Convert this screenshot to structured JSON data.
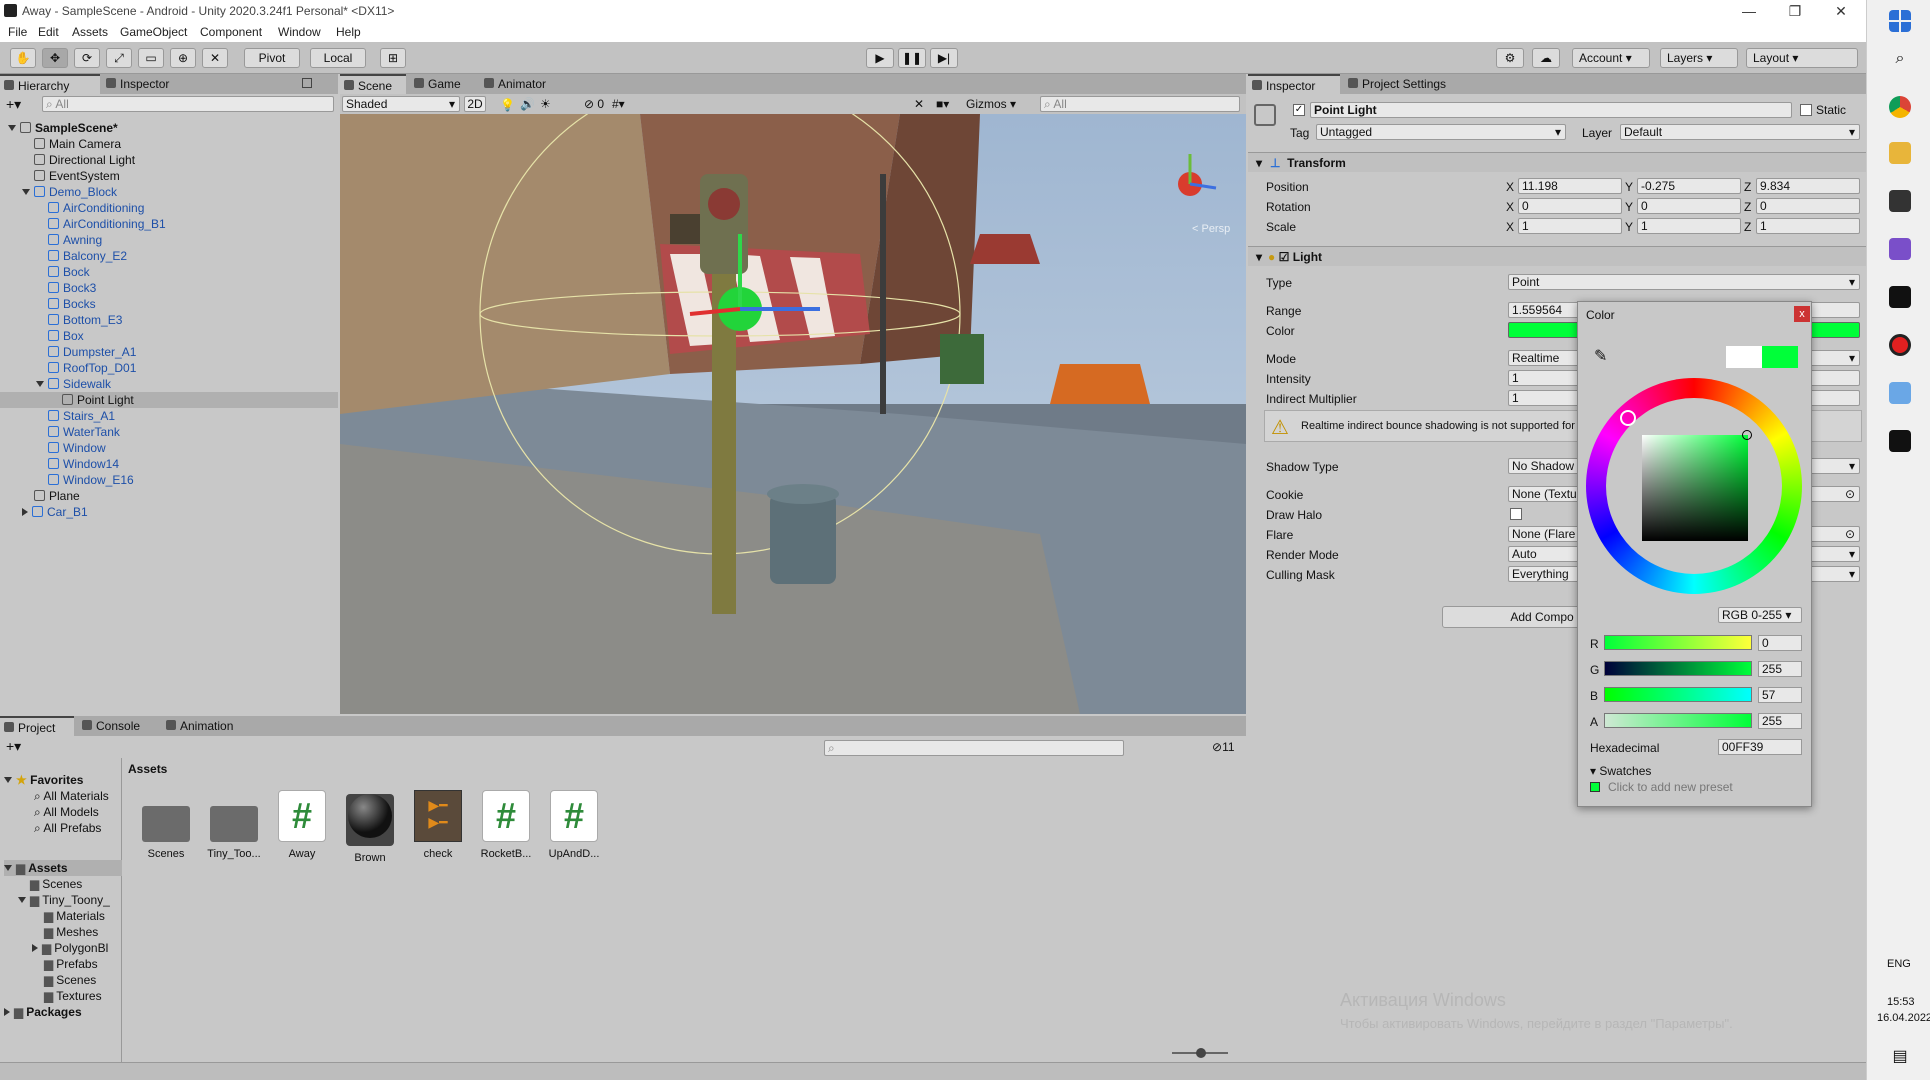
{
  "window": {
    "title": "Away - SampleScene - Android - Unity 2020.3.24f1 Personal* <DX11>"
  },
  "menu": [
    "File",
    "Edit",
    "Assets",
    "GameObject",
    "Component",
    "Window",
    "Help"
  ],
  "toolbar": {
    "pivot": "Pivot",
    "local": "Local",
    "account": "Account",
    "layers": "Layers",
    "layout": "Layout"
  },
  "hierarchy": {
    "tab": "Hierarchy",
    "inspector_tab": "Inspector",
    "search_placeholder": "All",
    "items": [
      {
        "label": "SampleScene*"
      },
      {
        "label": "Main Camera"
      },
      {
        "label": "Directional Light"
      },
      {
        "label": "EventSystem"
      },
      {
        "label": "Demo_Block"
      },
      {
        "label": "AirConditioning"
      },
      {
        "label": "AirConditioning_B1"
      },
      {
        "label": "Awning"
      },
      {
        "label": "Balcony_E2"
      },
      {
        "label": "Bock"
      },
      {
        "label": "Bock3"
      },
      {
        "label": "Bocks"
      },
      {
        "label": "Bottom_E3"
      },
      {
        "label": "Box"
      },
      {
        "label": "Dumpster_A1"
      },
      {
        "label": "RoofTop_D01"
      },
      {
        "label": "Sidewalk"
      },
      {
        "label": "Point Light"
      },
      {
        "label": "Stairs_A1"
      },
      {
        "label": "WaterTank"
      },
      {
        "label": "Window"
      },
      {
        "label": "Window14"
      },
      {
        "label": "Window_E16"
      },
      {
        "label": "Plane"
      },
      {
        "label": "Car_B1"
      }
    ]
  },
  "scene": {
    "tabs": [
      "Scene",
      "Game",
      "Animator"
    ],
    "shading": "Shaded",
    "mode2d": "2D",
    "hidden_count": "0",
    "gizmos": "Gizmos",
    "search_placeholder": "All",
    "persp": "< Persp"
  },
  "inspector": {
    "tabs": [
      "Inspector",
      "Project Settings"
    ],
    "object_name": "Point Light",
    "static_label": "Static",
    "tag_label": "Tag",
    "tag_value": "Untagged",
    "layer_label": "Layer",
    "layer_value": "Default",
    "transform": {
      "title": "Transform",
      "position_label": "Position",
      "rotation_label": "Rotation",
      "scale_label": "Scale",
      "position": {
        "x": "11.198",
        "y": "-0.275",
        "z": "9.834"
      },
      "rotation": {
        "x": "0",
        "y": "0",
        "z": "0"
      },
      "scale": {
        "x": "1",
        "y": "1",
        "z": "1"
      }
    },
    "light": {
      "title": "Light",
      "type_label": "Type",
      "type_value": "Point",
      "range_label": "Range",
      "range_value": "1.559564",
      "color_label": "Color",
      "mode_label": "Mode",
      "mode_value": "Realtime",
      "intensity_label": "Intensity",
      "intensity_value": "1",
      "indirect_label": "Indirect Multiplier",
      "indirect_value": "1",
      "warning": "Realtime indirect bounce shadowing is not supported for",
      "shadow_label": "Shadow Type",
      "shadow_value": "No Shadow",
      "cookie_label": "Cookie",
      "cookie_value": "None (Textu",
      "halo_label": "Draw Halo",
      "flare_label": "Flare",
      "flare_value": "None (Flare",
      "render_label": "Render Mode",
      "render_value": "Auto",
      "culling_label": "Culling Mask",
      "culling_value": "Everything"
    },
    "add_component": "Add Compo",
    "color_hex": "#00FF39"
  },
  "color_picker": {
    "title": "Color",
    "mode": "RGB 0-255",
    "r_label": "R",
    "r": "0",
    "g_label": "G",
    "g": "255",
    "b_label": "B",
    "b": "57",
    "a_label": "A",
    "a": "255",
    "hex_label": "Hexadecimal",
    "hex": "00FF39",
    "swatches": "Swatches",
    "swatch_hint": "Click to add new preset"
  },
  "project": {
    "tabs": [
      "Project",
      "Console",
      "Animation"
    ],
    "hidden_count": "11",
    "favorites": "Favorites",
    "fav_items": [
      "All Materials",
      "All Models",
      "All Prefabs"
    ],
    "tree": [
      {
        "label": "Assets"
      },
      {
        "label": "Scenes"
      },
      {
        "label": "Tiny_Toony_"
      },
      {
        "label": "Materials"
      },
      {
        "label": "Meshes"
      },
      {
        "label": "PolygonBl"
      },
      {
        "label": "Prefabs"
      },
      {
        "label": "Scenes"
      },
      {
        "label": "Textures"
      },
      {
        "label": "Packages"
      }
    ],
    "breadcrumb": "Assets",
    "assets": [
      {
        "label": "Scenes",
        "kind": "folder"
      },
      {
        "label": "Tiny_Too...",
        "kind": "folder"
      },
      {
        "label": "Away",
        "kind": "script"
      },
      {
        "label": "Brown",
        "kind": "material"
      },
      {
        "label": "check",
        "kind": "texture"
      },
      {
        "label": "RocketB...",
        "kind": "script"
      },
      {
        "label": "UpAndD...",
        "kind": "script"
      }
    ]
  },
  "watermark": {
    "line1": "Активация Windows",
    "line2": "Чтобы активировать Windows, перейдите в раздел \"Параметры\"."
  },
  "taskbar": {
    "lang": "ENG",
    "time": "15:53",
    "date": "16.04.2022"
  }
}
